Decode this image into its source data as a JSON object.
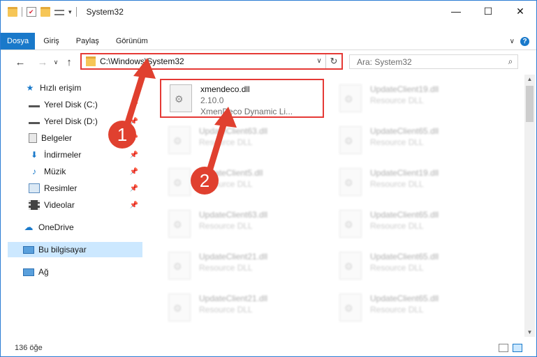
{
  "window": {
    "title": "System32",
    "minimize": "—",
    "maximize": "☐",
    "close": "✕"
  },
  "ribbon": {
    "tabs": [
      {
        "label": "Dosya"
      },
      {
        "label": "Giriş"
      },
      {
        "label": "Paylaş"
      },
      {
        "label": "Görünüm"
      }
    ],
    "collapse": "∨",
    "help": "?"
  },
  "nav": {
    "back": "←",
    "forward": "→",
    "recent": "∨",
    "up": "↑"
  },
  "address": {
    "path": "C:\\Windows\\System32",
    "dropdown": "∨",
    "refresh": "↻"
  },
  "search": {
    "placeholder": "Ara: System32",
    "icon": "⌕"
  },
  "sidebar": {
    "items": [
      {
        "label": "Hızlı erişim",
        "icon": "star-icon"
      },
      {
        "label": "Yerel Disk (C:)",
        "icon": "drive-icon"
      },
      {
        "label": "Yerel Disk (D:)",
        "icon": "drive-icon"
      },
      {
        "label": "Belgeler",
        "icon": "documents-icon"
      },
      {
        "label": "İndirmeler",
        "icon": "download-icon"
      },
      {
        "label": "Müzik",
        "icon": "music-icon"
      },
      {
        "label": "Resimler",
        "icon": "pictures-icon"
      },
      {
        "label": "Videolar",
        "icon": "video-icon"
      },
      {
        "label": "OneDrive",
        "icon": "cloud-icon"
      },
      {
        "label": "Bu bilgisayar",
        "icon": "computer-icon"
      },
      {
        "label": "Ağ",
        "icon": "network-icon"
      }
    ]
  },
  "files": [
    {
      "name": "xmendeco.dll",
      "version": "2.10.0",
      "desc": "XmenDeco Dynamic Li..."
    },
    {
      "name": "UpdateClient19.dll",
      "desc": "Resource DLL"
    },
    {
      "name": "UpdateClient63.dll",
      "desc": "Resource DLL"
    },
    {
      "name": "UpdateClient65.dll",
      "desc": "Resource DLL"
    },
    {
      "name": "UpdateClient5.dll",
      "desc": "Resource DLL"
    },
    {
      "name": "UpdateClient19.dll",
      "desc": "Resource DLL"
    },
    {
      "name": "UpdateClient63.dll",
      "desc": "Resource DLL"
    },
    {
      "name": "UpdateClient65.dll",
      "desc": "Resource DLL"
    },
    {
      "name": "UpdateClient21.dll",
      "desc": "Resource DLL"
    },
    {
      "name": "UpdateClient65.dll",
      "desc": "Resource DLL"
    },
    {
      "name": "UpdateClient21.dll",
      "desc": "Resource DLL"
    },
    {
      "name": "UpdateClient65.dll",
      "desc": "Resource DLL"
    }
  ],
  "status": {
    "count": "136 öğe"
  },
  "annotations": {
    "step1": "1",
    "step2": "2"
  },
  "colors": {
    "accent": "#1979ca",
    "highlight": "#e53935",
    "arrow": "#e0402f"
  }
}
